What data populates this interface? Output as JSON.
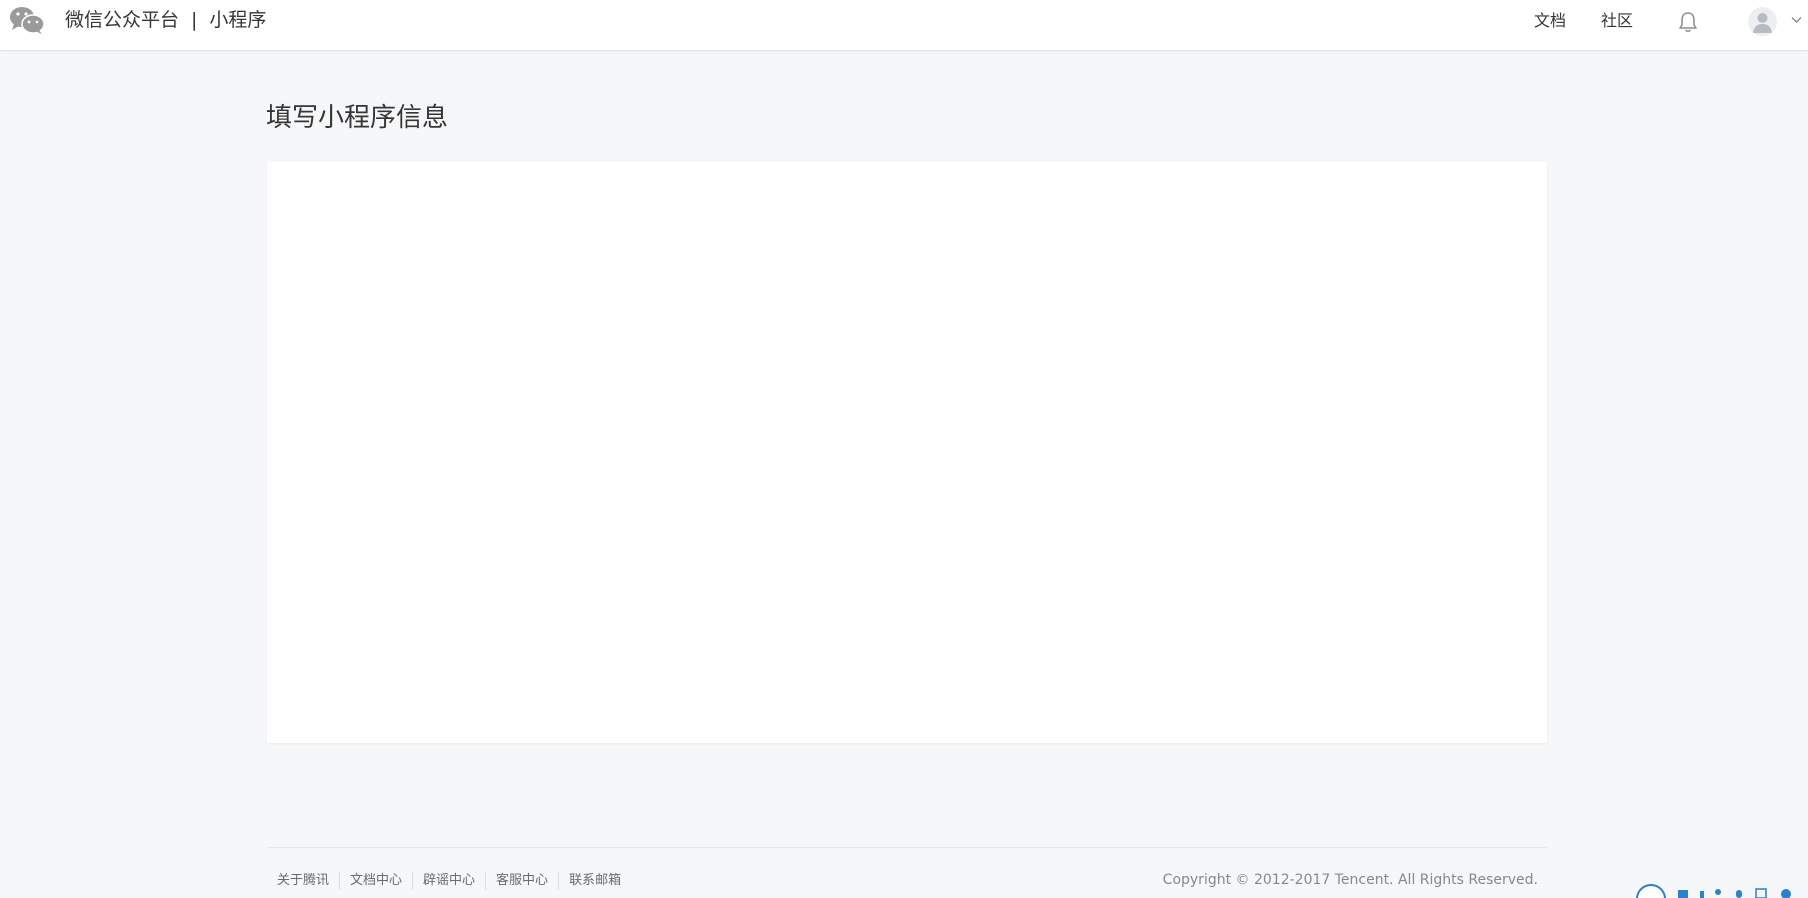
{
  "header": {
    "platform_name": "微信公众平台",
    "separator": "|",
    "product_name": "小程序",
    "nav": {
      "docs": "文档",
      "community": "社区"
    },
    "icons": {
      "logo": "wechat-logo-icon",
      "notification": "bell-icon",
      "avatar": "user-avatar-icon",
      "menu": "chevron-down-icon"
    }
  },
  "main": {
    "title": "填写小程序信息"
  },
  "footer": {
    "links": [
      "关于腾讯",
      "文档中心",
      "辟谣中心",
      "客服中心",
      "联系邮箱"
    ],
    "copyright": "Copyright © 2012-2017 Tencent. All Rights Reserved."
  },
  "colors": {
    "page_background": "#f6f7f9",
    "card_background": "#ffffff",
    "text_primary": "#353535",
    "text_secondary": "#888888",
    "ime_accent": "#2d7fd0"
  }
}
